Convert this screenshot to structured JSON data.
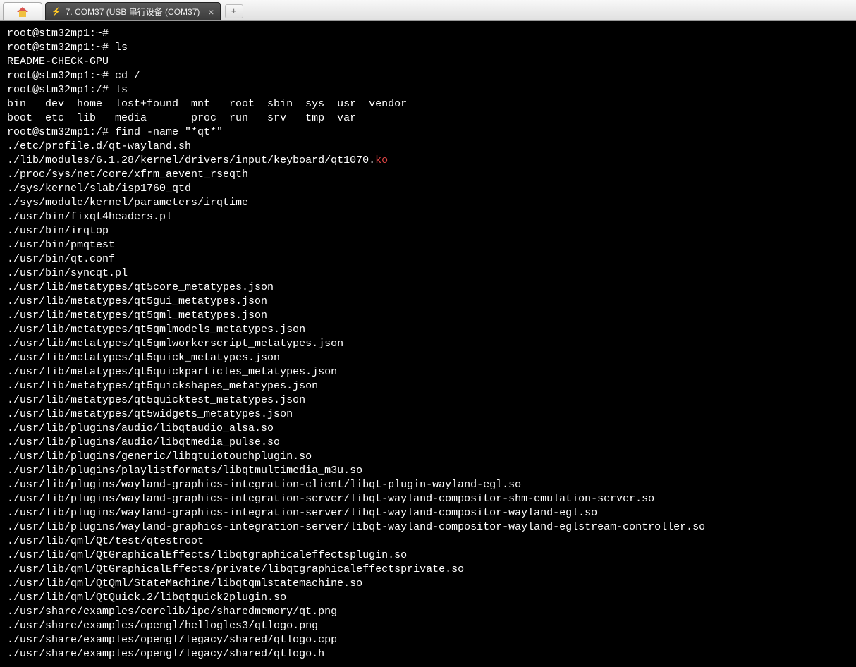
{
  "tabs": {
    "active_title": "7. COM37  (USB 串行设备 (COM37)",
    "close_glyph": "×",
    "new_glyph": "+"
  },
  "terminal": {
    "lines": [
      {
        "t": "root@stm32mp1:~#"
      },
      {
        "t": "root@stm32mp1:~# ls"
      },
      {
        "t": "README-CHECK-GPU"
      },
      {
        "t": "root@stm32mp1:~# cd /"
      },
      {
        "t": "root@stm32mp1:/# ls"
      },
      {
        "t": "bin   dev  home  lost+found  mnt   root  sbin  sys  usr  vendor"
      },
      {
        "t": "boot  etc  lib   media       proc  run   srv   tmp  var"
      },
      {
        "t": "root@stm32mp1:/# find -name \"*qt*\""
      },
      {
        "t": "./etc/profile.d/qt-wayland.sh"
      },
      {
        "t": "./lib/modules/6.1.28/kernel/drivers/input/keyboard/qt1070.",
        "suffix": "ko",
        "suffix_class": "ko"
      },
      {
        "t": "./proc/sys/net/core/xfrm_aevent_rseqth"
      },
      {
        "t": "./sys/kernel/slab/isp1760_qtd"
      },
      {
        "t": "./sys/module/kernel/parameters/irqtime"
      },
      {
        "t": "./usr/bin/fixqt4headers.pl"
      },
      {
        "t": "./usr/bin/irqtop"
      },
      {
        "t": "./usr/bin/pmqtest"
      },
      {
        "t": "./usr/bin/qt.conf"
      },
      {
        "t": "./usr/bin/syncqt.pl"
      },
      {
        "t": "./usr/lib/metatypes/qt5core_metatypes.json"
      },
      {
        "t": "./usr/lib/metatypes/qt5gui_metatypes.json"
      },
      {
        "t": "./usr/lib/metatypes/qt5qml_metatypes.json"
      },
      {
        "t": "./usr/lib/metatypes/qt5qmlmodels_metatypes.json"
      },
      {
        "t": "./usr/lib/metatypes/qt5qmlworkerscript_metatypes.json"
      },
      {
        "t": "./usr/lib/metatypes/qt5quick_metatypes.json"
      },
      {
        "t": "./usr/lib/metatypes/qt5quickparticles_metatypes.json"
      },
      {
        "t": "./usr/lib/metatypes/qt5quickshapes_metatypes.json"
      },
      {
        "t": "./usr/lib/metatypes/qt5quicktest_metatypes.json"
      },
      {
        "t": "./usr/lib/metatypes/qt5widgets_metatypes.json"
      },
      {
        "t": "./usr/lib/plugins/audio/libqtaudio_alsa.so"
      },
      {
        "t": "./usr/lib/plugins/audio/libqtmedia_pulse.so"
      },
      {
        "t": "./usr/lib/plugins/generic/libqtuiotouchplugin.so"
      },
      {
        "t": "./usr/lib/plugins/playlistformats/libqtmultimedia_m3u.so"
      },
      {
        "t": "./usr/lib/plugins/wayland-graphics-integration-client/libqt-plugin-wayland-egl.so"
      },
      {
        "t": "./usr/lib/plugins/wayland-graphics-integration-server/libqt-wayland-compositor-shm-emulation-server.so"
      },
      {
        "t": "./usr/lib/plugins/wayland-graphics-integration-server/libqt-wayland-compositor-wayland-egl.so"
      },
      {
        "t": "./usr/lib/plugins/wayland-graphics-integration-server/libqt-wayland-compositor-wayland-eglstream-controller.so"
      },
      {
        "t": "./usr/lib/qml/Qt/test/qtestroot"
      },
      {
        "t": "./usr/lib/qml/QtGraphicalEffects/libqtgraphicaleffectsplugin.so"
      },
      {
        "t": "./usr/lib/qml/QtGraphicalEffects/private/libqtgraphicaleffectsprivate.so"
      },
      {
        "t": "./usr/lib/qml/QtQml/StateMachine/libqtqmlstatemachine.so"
      },
      {
        "t": "./usr/lib/qml/QtQuick.2/libqtquick2plugin.so"
      },
      {
        "t": "./usr/share/examples/corelib/ipc/sharedmemory/qt.png"
      },
      {
        "t": "./usr/share/examples/opengl/hellogles3/qtlogo.png"
      },
      {
        "t": "./usr/share/examples/opengl/legacy/shared/qtlogo.cpp"
      },
      {
        "t": "./usr/share/examples/opengl/legacy/shared/qtlogo.h"
      }
    ]
  }
}
